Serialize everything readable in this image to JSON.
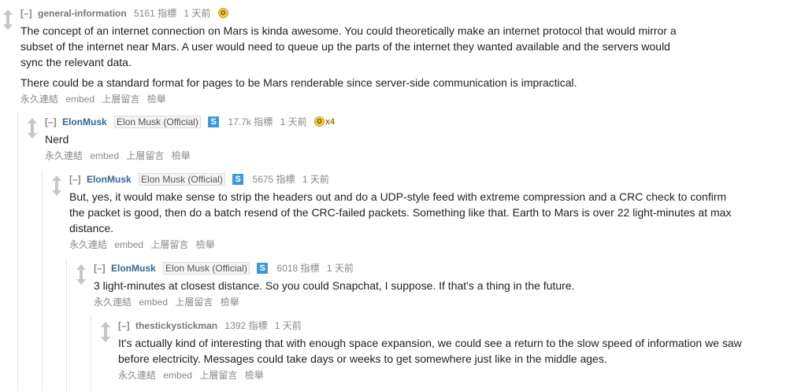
{
  "comments": [
    {
      "expand": "[–]",
      "author": "general-information",
      "flair": "",
      "score": "5161 指標",
      "time": "1 天前",
      "gilded_count": "",
      "paragraphs": [
        "The concept of an internet connection on Mars is kinda awesome. You could theoretically make an internet protocol that would mirror a subset of the internet near Mars. A user would need to queue up the parts of the internet they wanted available and the servers would sync the relevant data.",
        "There could be a standard format for pages to be Mars renderable since server-side communication is impractical."
      ],
      "buttons": [
        "永久連結",
        "embed",
        "上層留言",
        "檢舉"
      ]
    },
    {
      "expand": "[–]",
      "author": "ElonMusk",
      "flair": "Elon Musk (Official)",
      "badge": "S",
      "score": "17.7k 指標",
      "time": "1 天前",
      "gilded_count": "x4",
      "paragraphs": [
        "Nerd"
      ],
      "buttons": [
        "永久連結",
        "embed",
        "上層留言",
        "檢舉"
      ]
    },
    {
      "expand": "[–]",
      "author": "ElonMusk",
      "flair": "Elon Musk (Official)",
      "badge": "S",
      "score": "5675 指標",
      "time": "1 天前",
      "gilded_count": "",
      "paragraphs": [
        "But, yes, it would make sense to strip the headers out and do a UDP-style feed with extreme compression and a CRC check to confirm the packet is good, then do a batch resend of the CRC-failed packets. Something like that. Earth to Mars is over 22 light-minutes at max distance."
      ],
      "buttons": [
        "永久連結",
        "embed",
        "上層留言",
        "檢舉"
      ]
    },
    {
      "expand": "[–]",
      "author": "ElonMusk",
      "flair": "Elon Musk (Official)",
      "badge": "S",
      "score": "6018 指標",
      "time": "1 天前",
      "gilded_count": "",
      "paragraphs": [
        "3 light-minutes at closest distance. So you could Snapchat, I suppose. If that's a thing in the future."
      ],
      "buttons": [
        "永久連結",
        "embed",
        "上層留言",
        "檢舉"
      ]
    },
    {
      "expand": "[–]",
      "author": "thestickystickman",
      "flair": "",
      "score": "1392 指標",
      "time": "1 天前",
      "gilded_count": "",
      "paragraphs": [
        "It's actually kind of interesting that with enough space expansion, we could see a return to the slow speed of information we saw before electricity. Messages could take days or weeks to get somewhere just like in the middle ages."
      ],
      "buttons": [
        "永久連結",
        "embed",
        "上層留言",
        "檢舉"
      ]
    }
  ]
}
